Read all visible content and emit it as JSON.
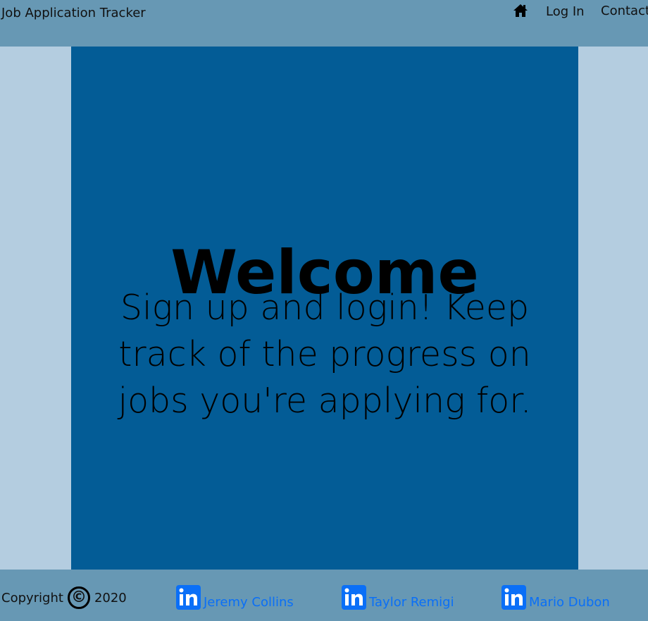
{
  "navbar": {
    "brand": "Job Application Tracker",
    "home_icon": "home-icon",
    "login_label": "Log In",
    "contact_label": "Contact"
  },
  "hero": {
    "title": "Welcome",
    "text": "Sign up and login! Keep track of the progress on jobs you're applying for."
  },
  "footer": {
    "copyright_label": "Copyright",
    "copyright_symbol": "©",
    "year": "2020",
    "authors": [
      {
        "name": "Jeremy Collins",
        "icon": "linkedin-icon"
      },
      {
        "name": "Taylor Remigi",
        "icon": "linkedin-icon"
      },
      {
        "name": "Mario Dubon",
        "icon": "linkedin-icon"
      }
    ]
  },
  "colors": {
    "page_background": "#b4cde0",
    "bar_background": "#6798b4",
    "hero_background": "#035c96",
    "link": "#0a6ff7",
    "linkedin_icon": "#0a6ff7"
  }
}
